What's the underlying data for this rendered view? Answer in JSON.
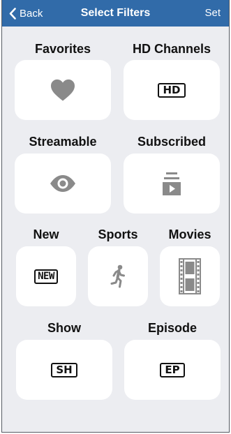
{
  "navbar": {
    "back_label": "Back",
    "title": "Select Filters",
    "set_label": "Set",
    "background": "#316ba9"
  },
  "filters": {
    "favorites": {
      "label": "Favorites",
      "icon": "heart-icon"
    },
    "hd_channels": {
      "label": "HD Channels",
      "icon": "hd-badge-icon",
      "badge": "HD"
    },
    "streamable": {
      "label": "Streamable",
      "icon": "eye-icon"
    },
    "subscribed": {
      "label": "Subscribed",
      "icon": "subscriptions-icon"
    },
    "new": {
      "label": "New",
      "icon": "new-badge-icon",
      "badge": "NEW"
    },
    "sports": {
      "label": "Sports",
      "icon": "running-person-icon"
    },
    "movies": {
      "label": "Movies",
      "icon": "film-strip-icon"
    },
    "show": {
      "label": "Show",
      "icon": "sh-badge-icon",
      "badge": "SH"
    },
    "episode": {
      "label": "Episode",
      "icon": "ep-badge-icon",
      "badge": "EP"
    }
  },
  "colors": {
    "background": "#ecedf1",
    "tile": "#ffffff",
    "icon_gray": "#8a8a8a"
  }
}
